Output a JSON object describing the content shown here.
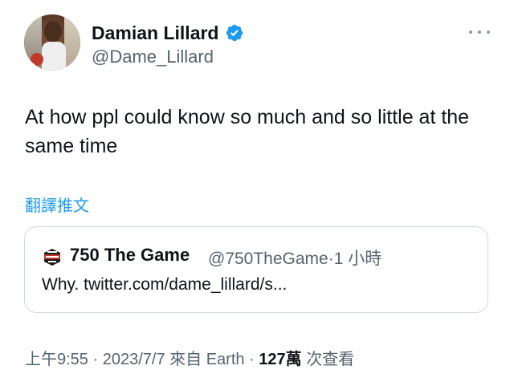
{
  "author": {
    "display_name": "Damian Lillard",
    "handle": "@Dame_Lillard",
    "verified": true
  },
  "tweet": {
    "text": "At how ppl could know so much and so little at the same time",
    "translate_label": "翻譯推文"
  },
  "quoted_tweet": {
    "avatar_text": "THE GAME 750",
    "display_name": "750 The Game",
    "handle": "@750TheGame",
    "separator": "·",
    "time_ago": "1 小時",
    "text": "Why. twitter.com/dame_lillard/s..."
  },
  "meta": {
    "time": "上午9:55",
    "sep1": " · ",
    "date": "2023/7/7",
    "source": " 來自 Earth",
    "sep2": " · ",
    "views_count": "127萬",
    "views_label": " 次查看"
  },
  "colors": {
    "link": "#1d9bf0",
    "secondary": "#536471",
    "primary": "#0f1419",
    "border": "#cfd9de",
    "verified": "#1d9bf0"
  },
  "icons": {
    "verified": "verified-badge-icon",
    "more": "more-horizontal-icon"
  }
}
